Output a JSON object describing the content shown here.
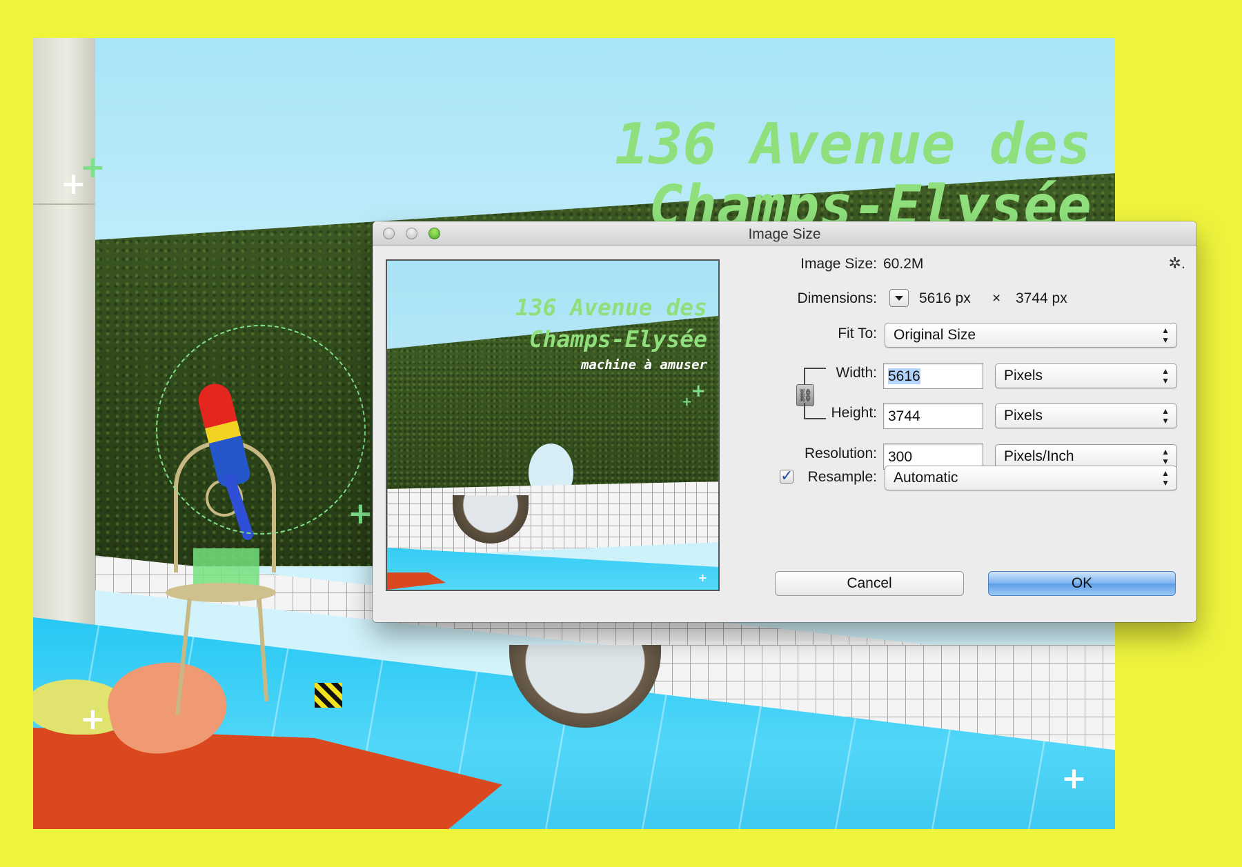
{
  "artwork": {
    "title_line1": "136 Avenue des",
    "title_line2": "Champs-Elysée",
    "subtitle": "machine à amuser"
  },
  "dialog": {
    "title": "Image Size",
    "image_size_label": "Image Size:",
    "image_size_value": "60.2M",
    "dimensions_label": "Dimensions:",
    "dimensions_width": "5616 px",
    "dimensions_times": "×",
    "dimensions_height": "3744 px",
    "fit_to_label": "Fit To:",
    "fit_to_value": "Original Size",
    "width_label": "Width:",
    "width_value": "5616",
    "width_unit": "Pixels",
    "height_label": "Height:",
    "height_value": "3744",
    "height_unit": "Pixels",
    "resolution_label": "Resolution:",
    "resolution_value": "300",
    "resolution_unit": "Pixels/Inch",
    "resample_label": "Resample:",
    "resample_checked": true,
    "resample_value": "Automatic",
    "cancel_label": "Cancel",
    "ok_label": "OK"
  },
  "icons": {
    "settings": "gear-icon",
    "constrain": "chain-link-icon",
    "popup_arrows": "up-down-chevron-icon",
    "dims_menu": "triangle-down-icon",
    "check": "checkmark-icon"
  },
  "colors": {
    "page_background": "#eef43c",
    "title_green": "#8fe07c",
    "ok_button": "#79b2ee",
    "selection_highlight": "#b3d4fd"
  }
}
